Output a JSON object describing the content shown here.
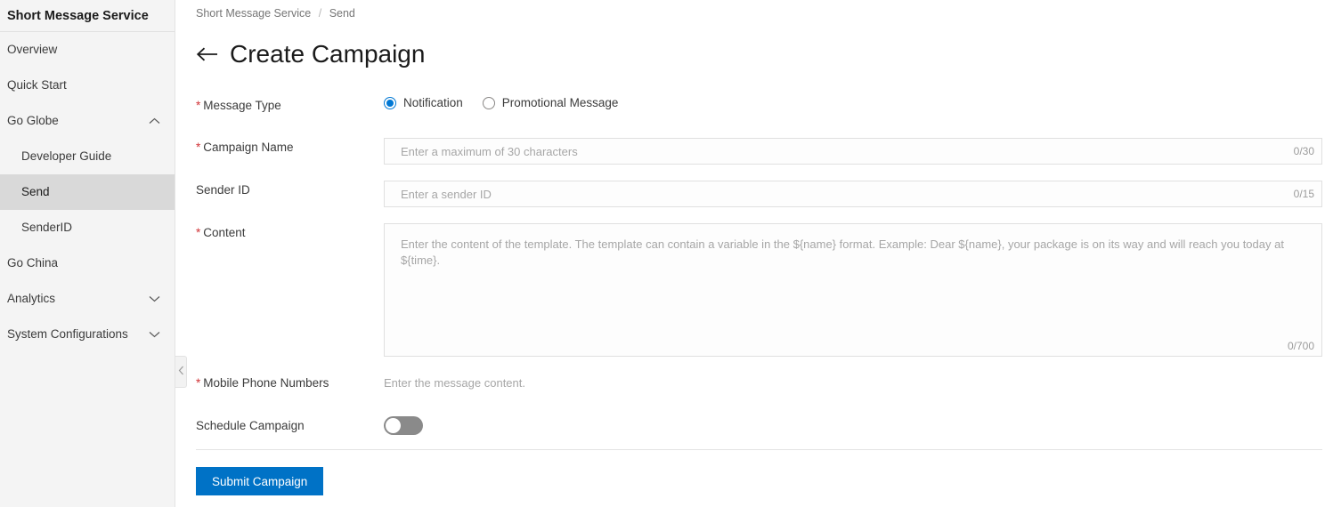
{
  "sidebar": {
    "title": "Short Message Service",
    "items": [
      {
        "label": "Overview",
        "level": 0,
        "chevron": "none",
        "active": false
      },
      {
        "label": "Quick Start",
        "level": 0,
        "chevron": "none",
        "active": false
      },
      {
        "label": "Go Globe",
        "level": 0,
        "chevron": "up",
        "active": false
      },
      {
        "label": "Developer Guide",
        "level": 1,
        "chevron": "none",
        "active": false
      },
      {
        "label": "Send",
        "level": 1,
        "chevron": "none",
        "active": true
      },
      {
        "label": "SenderID",
        "level": 1,
        "chevron": "none",
        "active": false
      },
      {
        "label": "Go China",
        "level": 0,
        "chevron": "none",
        "active": false
      },
      {
        "label": "Analytics",
        "level": 0,
        "chevron": "down",
        "active": false
      },
      {
        "label": "System Configurations",
        "level": 0,
        "chevron": "down",
        "active": false
      }
    ],
    "collapse_handle_icon": "chevron-left-icon"
  },
  "breadcrumb": {
    "root": "Short Message Service",
    "separator": "/",
    "current": "Send"
  },
  "header": {
    "back_icon": "arrow-left-icon",
    "title": "Create Campaign"
  },
  "form": {
    "message_type": {
      "label": "Message Type",
      "required": true,
      "options": [
        {
          "label": "Notification",
          "checked": true
        },
        {
          "label": "Promotional Message",
          "checked": false
        }
      ]
    },
    "campaign_name": {
      "label": "Campaign Name",
      "required": true,
      "value": "",
      "placeholder": "Enter a maximum of 30 characters",
      "counter": "0/30"
    },
    "sender_id": {
      "label": "Sender ID",
      "required": false,
      "value": "",
      "placeholder": "Enter a sender ID",
      "counter": "0/15"
    },
    "content": {
      "label": "Content",
      "required": true,
      "value": "",
      "placeholder": "Enter the content of the template. The template can contain a variable in the ${name} format. Example: Dear ${name}, your package is on its way and will reach you today at ${time}.",
      "counter": "0/700"
    },
    "mobile_phone_numbers": {
      "label": "Mobile Phone Numbers",
      "required": true,
      "helper": "Enter the message content."
    },
    "schedule_campaign": {
      "label": "Schedule Campaign",
      "required": false,
      "enabled": false
    },
    "submit_label": "Submit Campaign"
  },
  "colors": {
    "accent": "#0078d4",
    "submit_button": "#0072c6",
    "required_asterisk": "#d13438",
    "sidebar_bg": "#f4f4f4",
    "sidebar_active_bg": "#d9d9d9",
    "toggle_off": "#8a8a8a"
  }
}
